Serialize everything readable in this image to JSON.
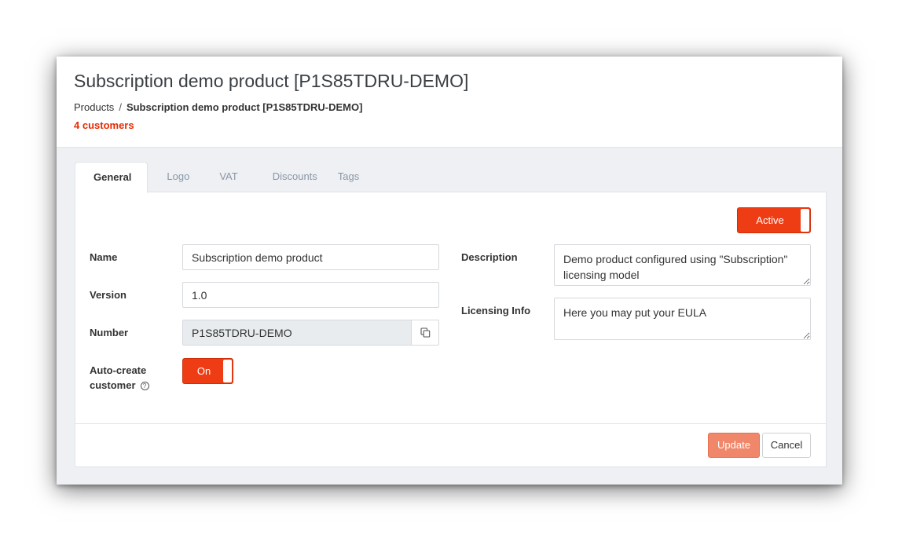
{
  "header": {
    "title": "Subscription demo product [P1S85TDRU-DEMO]",
    "breadcrumb": {
      "root": "Products",
      "separator": "/",
      "current": "Subscription demo product [P1S85TDRU-DEMO]"
    },
    "customers": "4 customers"
  },
  "tabs": [
    {
      "label": "General",
      "active": true
    },
    {
      "label": "Logo",
      "active": false
    },
    {
      "label": "VAT",
      "active": false
    },
    {
      "label": "Discounts",
      "active": false
    },
    {
      "label": "Tags",
      "active": false
    }
  ],
  "status_toggle": {
    "label": "Active",
    "on": true
  },
  "form": {
    "name": {
      "label": "Name",
      "value": "Subscription demo product"
    },
    "version": {
      "label": "Version",
      "value": "1.0"
    },
    "number": {
      "label": "Number",
      "value": "P1S85TDRU-DEMO"
    },
    "auto_create": {
      "label_line1": "Auto-create",
      "label_line2": "customer",
      "toggle_label": "On",
      "on": true
    },
    "description": {
      "label": "Description",
      "value": "Demo product configured using \"Subscription\" licensing model"
    },
    "licensing_info": {
      "label": "Licensing Info",
      "value": "Here you may put your EULA"
    }
  },
  "footer": {
    "update_label": "Update",
    "cancel_label": "Cancel"
  },
  "colors": {
    "accent": "#ee3d14",
    "customers_text": "#e62b00",
    "update_button": "#f0876a"
  },
  "icons": {
    "copy": "copy-icon",
    "help": "help-icon"
  }
}
